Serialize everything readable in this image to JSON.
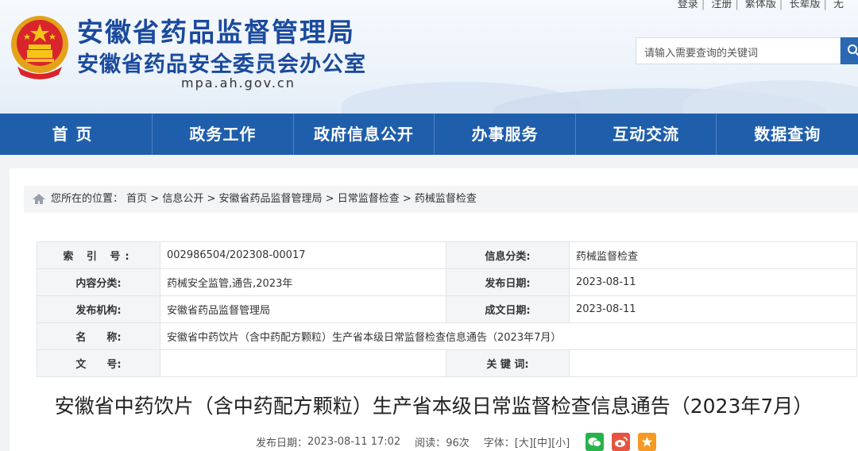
{
  "header": {
    "org_name": "安徽省药品监督管理局",
    "org_name_2": "安徽省药品安全委员会办公室",
    "domain": "mpa.ah.gov.cn",
    "top_links": [
      "登录",
      "注册",
      "繁体版",
      "长辈版",
      "无"
    ],
    "search_placeholder": "请输入需要查询的关键词"
  },
  "nav": [
    "首页",
    "政务工作",
    "政府信息公开",
    "办事服务",
    "互动交流",
    "数据查询"
  ],
  "breadcrumb": {
    "prefix": "您所在的位置：",
    "items": [
      "首页",
      "信息公开",
      "安徽省药品监督管理局",
      "日常监督检查",
      "药械监督检查"
    ]
  },
  "meta": {
    "index_label": "索 引 号:",
    "index_value": "002986504/202308-00017",
    "category_label": "信息分类:",
    "category_value": "药械监督检查",
    "content_label": "内容分类:",
    "content_value": "药械安全监管,通告,2023年",
    "pubdate_label": "发布日期:",
    "pubdate_value": "2023-08-11",
    "issuer_label": "发布机构:",
    "issuer_value": "安徽省药品监督管理局",
    "docdate_label": "成文日期:",
    "docdate_value": "2023-08-11",
    "name_label": "名　　称:",
    "name_value": "安徽省中药饮片（含中药配方颗粒）生产省本级日常监督检查信息通告（2023年7月）",
    "docno_label": "文　　号:",
    "docno_value": "",
    "keywords_label": "关 键 词:",
    "keywords_value": ""
  },
  "article": {
    "title": "安徽省中药饮片（含中药配方颗粒）生产省本级日常监督检查信息通告（2023年7月）",
    "pub_label": "发布日期：",
    "pub_value": "2023-08-11 17:02",
    "read_label": "阅读：",
    "read_value": "96次",
    "font_label": "字体：",
    "font_large": "[大]",
    "font_medium": "[中]",
    "font_small": "[小]"
  },
  "colors": {
    "brand": "#1f5eab",
    "title": "#1a4a9c"
  },
  "icons": [
    "national-emblem-icon",
    "search-icon",
    "home-icon",
    "wechat-icon",
    "weibo-icon",
    "favorite-icon"
  ]
}
